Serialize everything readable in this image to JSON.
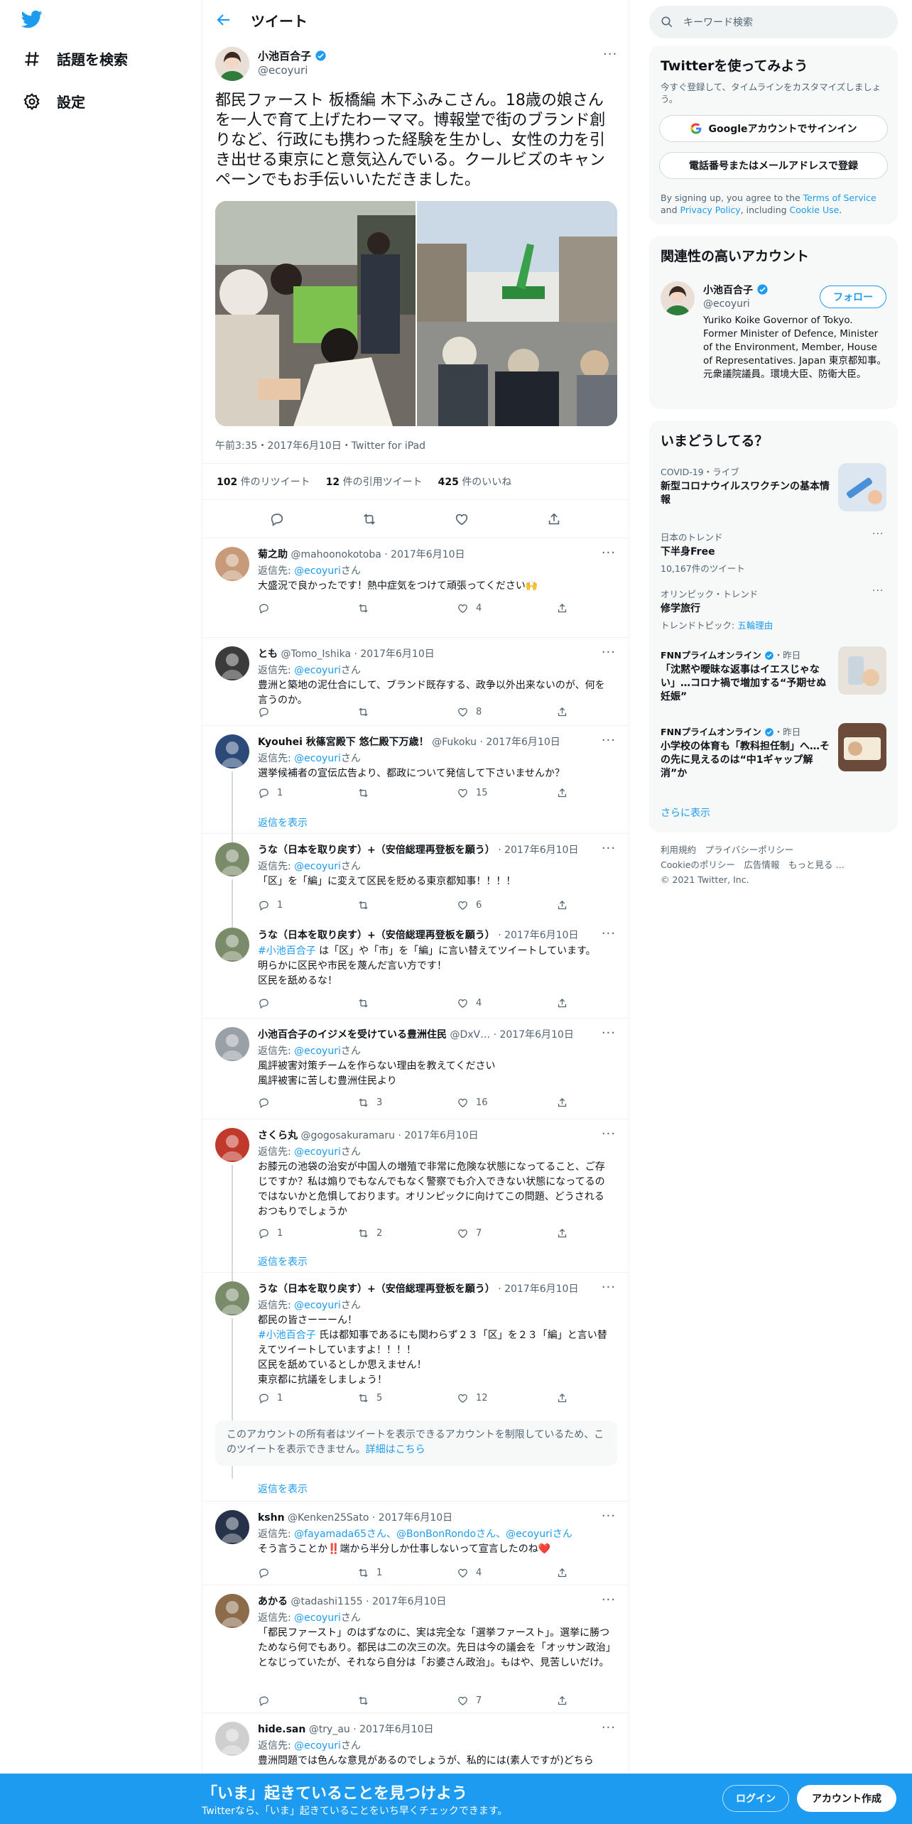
{
  "nav": {
    "explore": "話題を検索",
    "settings": "設定"
  },
  "header": {
    "title": "ツイート"
  },
  "tweet": {
    "name": "小池百合子",
    "handle": "@ecoyuri",
    "text": "都民ファースト 板橋編 木下ふみこさん。18歳の娘さんを一人で育て上げたわーママ。博報堂で街のブランド創りなど、行政にも携わった経験を生かし、女性の力を引き出せる東京にと意気込んでいる。クールビズのキャンペーンでもお手伝いいただきました。",
    "meta": "午前3:35・2017年6月10日・Twitter for iPad",
    "retweets": "102",
    "retweets_label": "件のリツイート",
    "quotes": "12",
    "quotes_label": "件の引用ツイート",
    "likes": "425",
    "likes_label": "件のいいね"
  },
  "replying_to": "返信先:",
  "san": "さん",
  "show_replies": "返信を表示",
  "replies": [
    {
      "name": "菊之助",
      "handle": "@mahoonokotoba",
      "date": "· 2017年6月10日",
      "to": "@ecoyuri",
      "text": "大盛況で良かったです！熱中症気をつけて頑張ってください🙌",
      "reply": "",
      "rt": "",
      "like": "4"
    },
    {
      "name": "とも",
      "handle": "@Tomo_Ishika",
      "date": "· 2017年6月10日",
      "to": "@ecoyuri",
      "text": "豊洲と築地の泥仕合にして、ブランド既存する、政争以外出来ないのが、何を言うのか。",
      "reply": "",
      "rt": "",
      "like": "8"
    },
    {
      "name": "Kyouhei 秋篠宮殿下 悠仁殿下万歳！",
      "handle": "@Fukoku",
      "date": "· 2017年6月10日",
      "to": "@ecoyuri",
      "text": "選挙候補者の宣伝広告より、都政について発信して下さいませんか？",
      "reply": "1",
      "rt": "",
      "like": "15"
    },
    {
      "name": "うな（日本を取り戻す）+（安倍総理再登板を願う）",
      "handle": "",
      "date": "· 2017年6月10日",
      "to": "@ecoyuri",
      "text": "「区」を「編」に変えて区民を貶める東京都知事！！！！",
      "reply": "1",
      "rt": "",
      "like": "6"
    },
    {
      "name": "うな（日本を取り戻す）+（安倍総理再登板を願う）",
      "handle": "",
      "date": "· 2017年6月10日",
      "tag": "#小池百合子",
      "text": " は「区」や「市」を「編」に言い替えてツイートしています。\n明らかに区民や市民を蔑んだ言い方です！\n区民を舐めるな！",
      "reply": "",
      "rt": "",
      "like": "4"
    },
    {
      "name": "小池百合子のイジメを受けている豊洲住民",
      "handle": "@DxV…",
      "date": "· 2017年6月10日",
      "to": "@ecoyuri",
      "text": "風評被害対策チームを作らない理由を教えてください\n風評被害に苦しむ豊洲住民より",
      "reply": "",
      "rt": "3",
      "like": "16"
    },
    {
      "name": "さくら丸",
      "handle": "@gogosakuramaru",
      "date": "· 2017年6月10日",
      "to": "@ecoyuri",
      "text": "お膝元の池袋の治安が中国人の増殖で非常に危険な状態になってること、ご存じですか？私は煽りでもなんでもなく警察でも介入できない状態になってるのではないかと危惧しております。オリンピックに向けてこの問題、どうされるおつもりでしょうか",
      "reply": "1",
      "rt": "2",
      "like": "7"
    },
    {
      "name": "うな（日本を取り戻す）+（安倍総理再登板を願う）",
      "handle": "",
      "date": "· 2017年6月10日",
      "to": "@ecoyuri",
      "text_pre": "都民の皆さーーーん！",
      "tag": "#小池百合子",
      "text": " 氏は都知事であるにも関わらず２３「区」を２３「編」と言い替えてツイートしていますよ！！！！\n区民を舐めているとしか思えません！\n東京都に抗議をしましょう！",
      "reply": "1",
      "rt": "5",
      "like": "12"
    },
    {
      "name": "kshn",
      "handle": "@Kenken25Sato",
      "date": "· 2017年6月10日",
      "to_multi": "@fayamada65さん、@BonBonRondoさん、@ecoyuriさん",
      "text": "そう言うことか‼️端から半分しか仕事しないって宣言したのね❤️",
      "reply": "",
      "rt": "1",
      "like": "4"
    },
    {
      "name": "あかる",
      "handle": "@tadashi1155",
      "date": "· 2017年6月10日",
      "to": "@ecoyuri",
      "text": "「都民ファースト」のはずなのに、実は完全な「選挙ファースト」。選挙に勝つためなら何でもあり。都民は二の次三の次。先日は今の議会を「オッサン政治」となじっていたが、それなら自分は「お婆さん政治」。もはや、見苦しいだけ。",
      "reply": "",
      "rt": "",
      "like": "7"
    },
    {
      "name": "hide.san",
      "handle": "@try_au",
      "date": "· 2017年6月10日",
      "to": "@ecoyuri",
      "text": "豊洲問題では色んな意見があるのでしょうが、私的には(素人ですが)どちら",
      "reply": "",
      "rt": "",
      "like": ""
    }
  ],
  "notice": {
    "text": "このアカウントの所有者はツイートを表示できるアカウントを制限しているため、このツイートを表示できません。",
    "link": "詳細はこちら"
  },
  "search": {
    "placeholder": "キーワード検索"
  },
  "signup_card": {
    "title": "Twitterを使ってみよう",
    "subtitle": "今すぐ登録して、タイムラインをカスタマイズしましょう。",
    "google": "Googleアカウントでサインイン",
    "phone": "電話番号またはメールアドレスで登録",
    "legal_1": "By signing up, you agree to the ",
    "terms": "Terms of Service",
    "legal_2": " and ",
    "privacy": "Privacy Policy",
    "legal_3": ", including ",
    "cookie": "Cookie Use",
    "legal_4": "."
  },
  "relevant": {
    "title": "関連性の高いアカウント",
    "name": "小池百合子",
    "handle": "@ecoyuri",
    "follow": "フォロー",
    "bio": "Yuriko Koike Governor of Tokyo. Former Minister of Defence, Minister of the Environment, Member, House of Representatives. Japan 東京都知事。元衆議院議員。環境大臣、防衛大臣。"
  },
  "trends": {
    "title": "いまどうしてる？",
    "items": [
      {
        "cat": "COVID-19・ライブ",
        "title": "新型コロナウイルスワクチンの基本情報"
      },
      {
        "cat": "日本のトレンド",
        "title": "下半身Free",
        "sub": "10,167件のツイート"
      },
      {
        "cat": "オリンピック・トレンド",
        "title": "修学旅行",
        "sub_pre": "トレンドトピック: ",
        "sub_link": "五輪理由"
      },
      {
        "cat": "FNNプライムオンライン",
        "time": "・昨日",
        "title": "「沈黙や曖昧な返事はイエスじゃない」…コロナ禍で増加する“予期せぬ妊娠”"
      },
      {
        "cat": "FNNプライムオンライン",
        "time": "・昨日",
        "title": "小学校の体育も「教科担任制」へ…その先に見えるのは“中1ギャップ解消”か"
      }
    ],
    "more": "さらに表示"
  },
  "footer": {
    "line1": "利用規約　プライバシーポリシー",
    "line2": "Cookieのポリシー　広告情報　もっと見る …",
    "line3": "© 2021 Twitter, Inc."
  },
  "bottom_bar": {
    "title": "「いま」起きていることを見つけよう",
    "subtitle": "Twitterなら、「いま」起きていることをいち早くチェックできます。",
    "login": "ログイン",
    "signup": "アカウント作成"
  },
  "colors": {
    "accent": "#1d9bf0",
    "text": "#0f1419",
    "muted": "#536471",
    "panel": "#f7f9f9",
    "border": "#eff3f4"
  }
}
